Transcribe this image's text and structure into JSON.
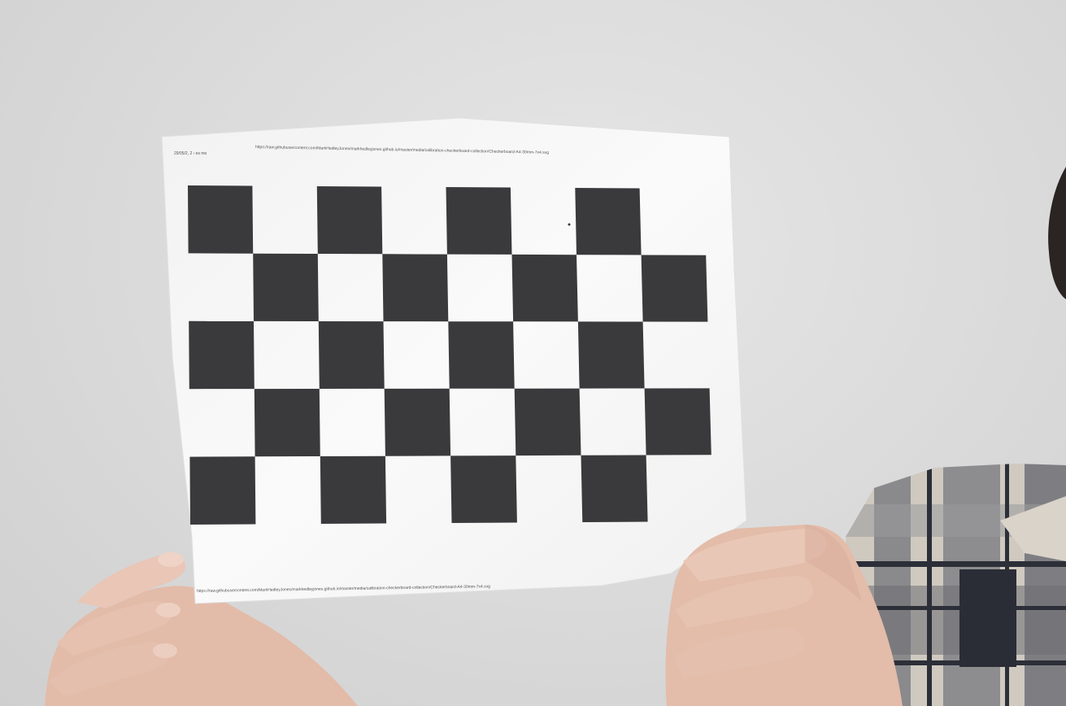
{
  "scene": {
    "subject": "printed-checkerboard-calibration-sheet",
    "colors": {
      "wall": "#dcdcdc",
      "paper": "#f7f7f7",
      "square": "#3a3a3c",
      "skin": "#e7c3b3",
      "shirt_light": "#cfc9c0",
      "shirt_gray": "#8a8a8c",
      "shirt_dark": "#2c2f38"
    },
    "checkerboard": {
      "rows": 5,
      "cols": 8
    },
    "sheet": {
      "header_left": "29/05/2, 2 ‹ es mo",
      "header_url": "https://raw.githubusercontent.com/MarkHedleyJones/markhedleyjones.github.io/master/media/calibration-checkerboard-collection/Checkerboard-A4-30mm-7x4.svg",
      "footer_url": "https://raw.githubusercontent.com/MarkHedleyJones/markhedleyjones.github.io/master/media/calibration-checkerboard-collection/Checkerboard-A4-30mm-7x4.svg"
    }
  }
}
